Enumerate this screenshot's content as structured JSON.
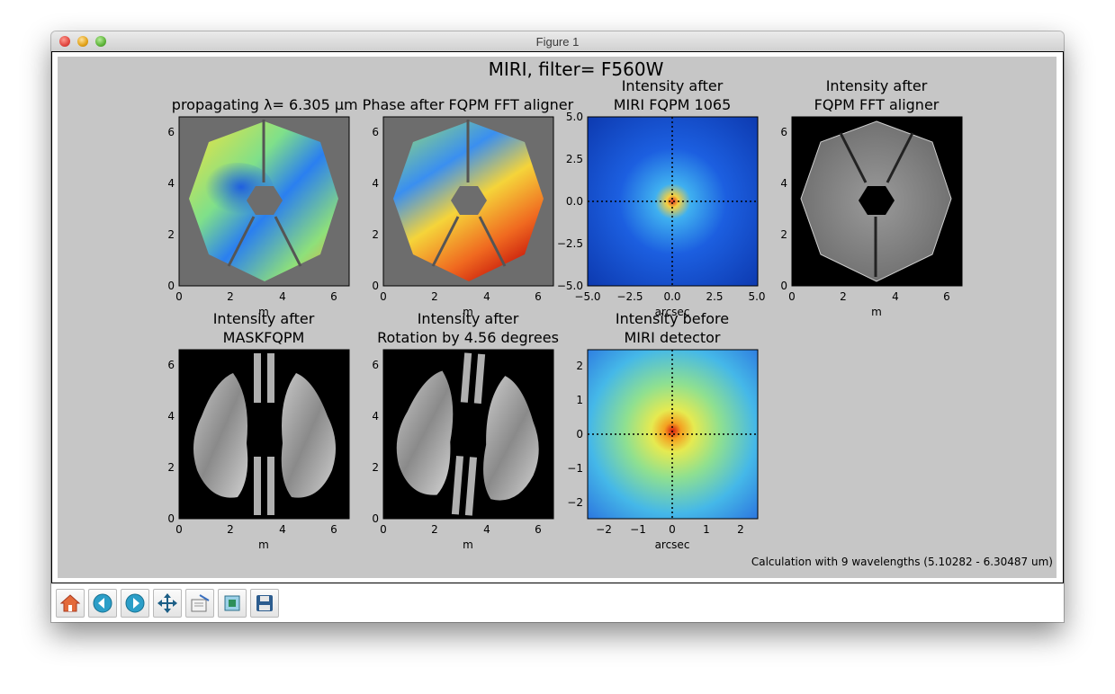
{
  "window": {
    "title": "Figure 1"
  },
  "figure": {
    "suptitle": "MIRI, filter= F560W",
    "footnote": "Calculation with 9 wavelengths (5.10282 - 6.30487 um)",
    "panels": [
      {
        "title1": "",
        "title2": "propagating λ= 6.305 μm Phase after FQPM FFT aligner",
        "xlabel": "m",
        "xticks": [
          "0",
          "2",
          "4",
          "6"
        ],
        "yticks": [
          "0",
          "2",
          "4",
          "6"
        ]
      },
      {
        "title1": "",
        "title2": "",
        "xlabel": "m",
        "xticks": [
          "0",
          "2",
          "4",
          "6"
        ],
        "yticks": [
          "0",
          "2",
          "4",
          "6"
        ]
      },
      {
        "title1": "Intensity after",
        "title2": "MIRI FQPM 1065",
        "xlabel": "arcsec",
        "xticks": [
          "−5.0",
          "−2.5",
          "0.0",
          "2.5",
          "5.0"
        ],
        "yticks": [
          "−5.0",
          "−2.5",
          "0.0",
          "2.5",
          "5.0"
        ]
      },
      {
        "title1": "Intensity after",
        "title2": "FQPM FFT aligner",
        "xlabel": "m",
        "xticks": [
          "0",
          "2",
          "4",
          "6"
        ],
        "yticks": [
          "0",
          "2",
          "4",
          "6"
        ]
      },
      {
        "title1": "Intensity after",
        "title2": "MASKFQPM",
        "xlabel": "m",
        "xticks": [
          "0",
          "2",
          "4",
          "6"
        ],
        "yticks": [
          "0",
          "2",
          "4",
          "6"
        ]
      },
      {
        "title1": "Intensity after",
        "title2": "Rotation by 4.56 degrees",
        "xlabel": "m",
        "xticks": [
          "0",
          "2",
          "4",
          "6"
        ],
        "yticks": [
          "0",
          "2",
          "4",
          "6"
        ]
      },
      {
        "title1": "Intensity before",
        "title2": "MIRI detector",
        "xlabel": "arcsec",
        "xticks": [
          "−2",
          "−1",
          "0",
          "1",
          "2"
        ],
        "yticks": [
          "−2",
          "−1",
          "0",
          "1",
          "2"
        ]
      }
    ]
  },
  "toolbar": {
    "buttons": [
      {
        "icon": "home-icon"
      },
      {
        "icon": "back-arrow-icon"
      },
      {
        "icon": "forward-arrow-icon"
      },
      {
        "icon": "pan-icon"
      },
      {
        "icon": "zoom-rect-icon"
      },
      {
        "icon": "subplots-icon"
      },
      {
        "icon": "save-icon"
      }
    ]
  }
}
